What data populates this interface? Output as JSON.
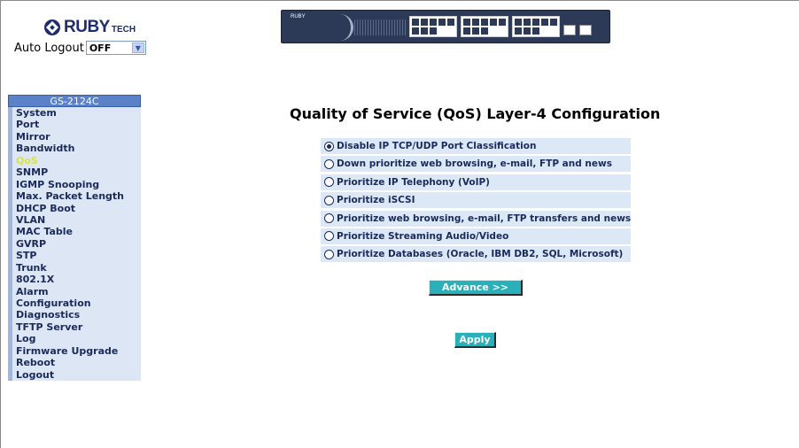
{
  "header": {
    "logo_text": "RUBY",
    "logo_sub": "TECH",
    "auto_logout_label": "Auto Logout",
    "auto_logout_value": "OFF",
    "device_brand": "RUBY"
  },
  "sidebar": {
    "title": "GS-2124C",
    "active": "QoS",
    "items": [
      {
        "label": "System"
      },
      {
        "label": "Port"
      },
      {
        "label": "Mirror"
      },
      {
        "label": "Bandwidth"
      },
      {
        "label": "QoS"
      },
      {
        "label": "SNMP"
      },
      {
        "label": "IGMP Snooping"
      },
      {
        "label": "Max. Packet Length"
      },
      {
        "label": "DHCP Boot"
      },
      {
        "label": "VLAN"
      },
      {
        "label": "MAC Table"
      },
      {
        "label": "GVRP"
      },
      {
        "label": "STP"
      },
      {
        "label": "Trunk"
      },
      {
        "label": "802.1X"
      },
      {
        "label": "Alarm"
      },
      {
        "label": "Configuration"
      },
      {
        "label": "Diagnostics"
      },
      {
        "label": "TFTP Server"
      },
      {
        "label": "Log"
      },
      {
        "label": "Firmware Upgrade"
      },
      {
        "label": "Reboot"
      },
      {
        "label": "Logout"
      }
    ]
  },
  "main": {
    "title": "Quality of Service (QoS) Layer-4 Configuration",
    "options": [
      {
        "label": "Disable IP TCP/UDP Port Classification",
        "checked": true
      },
      {
        "label": "Down prioritize web browsing, e-mail, FTP and news",
        "checked": false
      },
      {
        "label": "Prioritize IP Telephony (VoIP)",
        "checked": false
      },
      {
        "label": "Prioritize iSCSI",
        "checked": false
      },
      {
        "label": "Prioritize web browsing, e-mail, FTP transfers and news",
        "checked": false
      },
      {
        "label": "Prioritize Streaming Audio/Video",
        "checked": false
      },
      {
        "label": "Prioritize Databases (Oracle, IBM DB2, SQL, Microsoft)",
        "checked": false
      }
    ],
    "advance_label": "Advance >>",
    "apply_label": "Apply"
  },
  "colors": {
    "accent_button": "#2ab0b8",
    "sidebar_header": "#5b82c9",
    "menu_bg": "#dde6f4",
    "active_menu_text": "#d9e34a"
  }
}
